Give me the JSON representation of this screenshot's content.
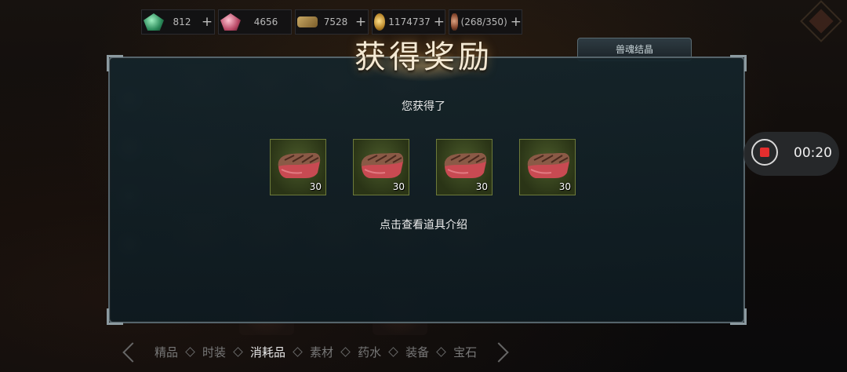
{
  "currencies": [
    {
      "icon": "green-gem-icon",
      "value": "812",
      "has_plus": true
    },
    {
      "icon": "pink-gem-icon",
      "value": "4656",
      "has_plus": false
    },
    {
      "icon": "ticket-icon",
      "value": "7528",
      "has_plus": true
    },
    {
      "icon": "gold-coins-icon",
      "value": "1174737",
      "has_plus": true
    },
    {
      "icon": "meat-stamina-icon",
      "value": "(268/350)",
      "has_plus": true
    }
  ],
  "beast_tab_label": "兽魂结晶",
  "dialog": {
    "title": "获得奖励",
    "subtitle": "您获得了",
    "hint": "点击查看道具介绍",
    "rewards": [
      {
        "icon": "steak-icon",
        "quantity": "30"
      },
      {
        "icon": "steak-icon",
        "quantity": "30"
      },
      {
        "icon": "steak-icon",
        "quantity": "30"
      },
      {
        "icon": "steak-icon",
        "quantity": "30"
      }
    ]
  },
  "recorder": {
    "time": "00:20",
    "accent": "#e52e2e"
  },
  "categories": [
    {
      "label": "精品",
      "active": false
    },
    {
      "label": "时装",
      "active": false
    },
    {
      "label": "消耗品",
      "active": true
    },
    {
      "label": "素材",
      "active": false
    },
    {
      "label": "药水",
      "active": false
    },
    {
      "label": "装备",
      "active": false
    },
    {
      "label": "宝石",
      "active": false
    }
  ]
}
